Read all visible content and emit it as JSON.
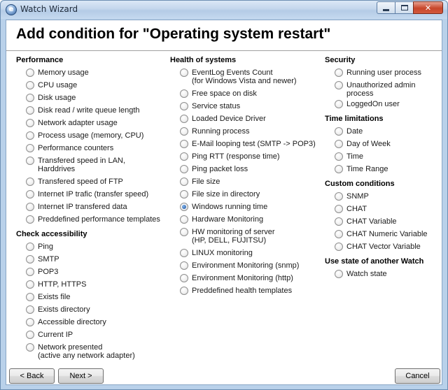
{
  "window": {
    "title": "Watch Wizard",
    "icon_glyph": "e",
    "close_glyph": "✕"
  },
  "heading": "Add condition for \"Operating system restart\"",
  "columns": [
    {
      "groups": [
        {
          "title": "Performance",
          "options": [
            {
              "label": "Memory usage",
              "checked": false
            },
            {
              "label": "CPU usage",
              "checked": false
            },
            {
              "label": "Disk usage",
              "checked": false
            },
            {
              "label": "Disk read / write queue length",
              "checked": false
            },
            {
              "label": "Network adapter usage",
              "checked": false
            },
            {
              "label": "Process usage (memory, CPU)",
              "checked": false
            },
            {
              "label": "Performance counters",
              "checked": false
            },
            {
              "label": "Transfered speed in LAN,\nHarddrives",
              "checked": false
            },
            {
              "label": "Transfered speed of FTP",
              "checked": false
            },
            {
              "label": "Internet IP trafic (transfer speed)",
              "checked": false
            },
            {
              "label": "Internet IP transfered data",
              "checked": false
            },
            {
              "label": "Preddefined performance templates",
              "checked": false
            }
          ]
        },
        {
          "title": "Check accessibility",
          "options": [
            {
              "label": "Ping",
              "checked": false
            },
            {
              "label": "SMTP",
              "checked": false
            },
            {
              "label": "POP3",
              "checked": false
            },
            {
              "label": "HTTP, HTTPS",
              "checked": false
            },
            {
              "label": "Exists file",
              "checked": false
            },
            {
              "label": "Exists directory",
              "checked": false
            },
            {
              "label": "Accessible directory",
              "checked": false
            },
            {
              "label": "Current IP",
              "checked": false
            },
            {
              "label": "Network presented\n(active any network adapter)",
              "checked": false
            }
          ]
        }
      ]
    },
    {
      "groups": [
        {
          "title": "Health of systems",
          "options": [
            {
              "label": "EventLog Events Count\n(for Windows Vista and newer)",
              "checked": false
            },
            {
              "label": "Free space on disk",
              "checked": false
            },
            {
              "label": "Service status",
              "checked": false
            },
            {
              "label": "Loaded Device Driver",
              "checked": false
            },
            {
              "label": "Running process",
              "checked": false
            },
            {
              "label": "E-Mail looping test (SMTP -> POP3)",
              "checked": false
            },
            {
              "label": "Ping RTT (response time)",
              "checked": false
            },
            {
              "label": "Ping packet loss",
              "checked": false
            },
            {
              "label": "File size",
              "checked": false
            },
            {
              "label": "File size in directory",
              "checked": false
            },
            {
              "label": "Windows running time",
              "checked": true
            },
            {
              "label": "Hardware Monitoring",
              "checked": false
            },
            {
              "label": "HW monitoring of server\n(HP, DELL, FUJITSU)",
              "checked": false
            },
            {
              "label": "LINUX monitoring",
              "checked": false
            },
            {
              "label": "Environment Monitoring (snmp)",
              "checked": false
            },
            {
              "label": "Environment Monitoring (http)",
              "checked": false
            },
            {
              "label": "Preddefined health templates",
              "checked": false
            }
          ]
        }
      ]
    },
    {
      "groups": [
        {
          "title": "Security",
          "options": [
            {
              "label": "Running user process",
              "checked": false
            },
            {
              "label": "Unauthorized admin process",
              "checked": false
            },
            {
              "label": "LoggedOn user",
              "checked": false
            }
          ]
        },
        {
          "title": "Time limitations",
          "options": [
            {
              "label": "Date",
              "checked": false
            },
            {
              "label": "Day of Week",
              "checked": false
            },
            {
              "label": "Time",
              "checked": false
            },
            {
              "label": "Time Range",
              "checked": false
            }
          ]
        },
        {
          "title": "Custom conditions",
          "options": [
            {
              "label": "SNMP",
              "checked": false
            },
            {
              "label": "CHAT",
              "checked": false
            },
            {
              "label": "CHAT Variable",
              "checked": false
            },
            {
              "label": "CHAT Numeric Variable",
              "checked": false
            },
            {
              "label": "CHAT Vector Variable",
              "checked": false
            }
          ]
        },
        {
          "title": "Use state of another Watch",
          "options": [
            {
              "label": "Watch state",
              "checked": false
            }
          ]
        }
      ]
    }
  ],
  "buttons": {
    "back": "< Back",
    "next": "Next >",
    "cancel": "Cancel"
  }
}
